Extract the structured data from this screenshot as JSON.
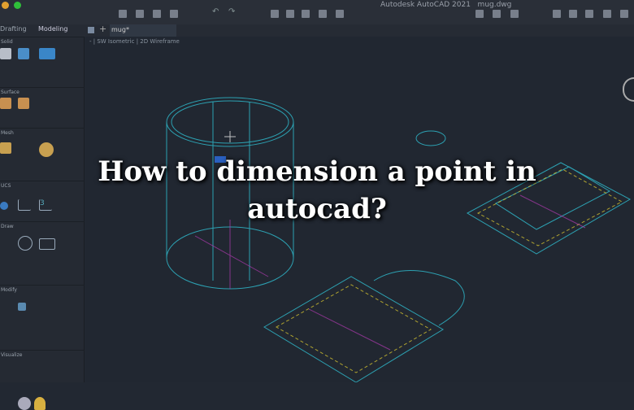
{
  "window": {
    "app_title": "Autodesk AutoCAD 2021",
    "file_name": "mug.dwg"
  },
  "workspace_tabs": [
    "Drafting",
    "Modeling"
  ],
  "document_tab": {
    "label": "mug*"
  },
  "viewport": {
    "view": "SW Isometric",
    "visual_style": "2D Wireframe",
    "minus": "-"
  },
  "panels": [
    "Solid",
    "Surface",
    "Mesh",
    "UCS",
    "Draw",
    "Modify",
    "Visualize"
  ],
  "overlay": {
    "line1": "How to dimension a point in",
    "line2": "autocad?"
  },
  "colors": {
    "drawing": "#2fb6c8",
    "dashed": "#c8b830",
    "axis": "#b03ab0"
  }
}
